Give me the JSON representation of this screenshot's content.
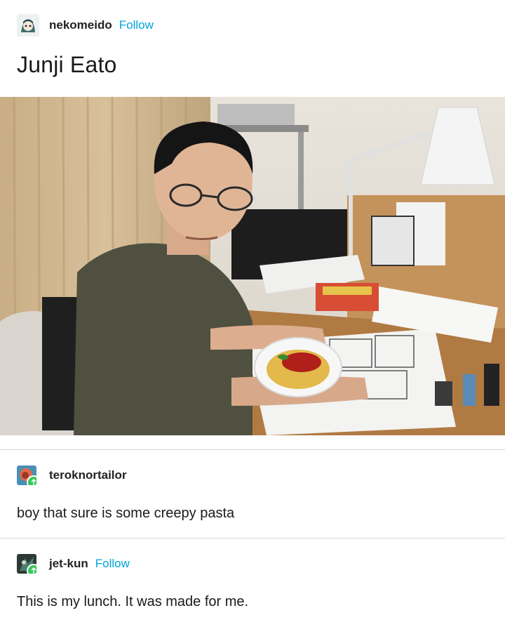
{
  "post": {
    "author": "nekomeido",
    "follow_label": "Follow",
    "title": "Junji Eato"
  },
  "reblogs": [
    {
      "author": "teroknortailor",
      "text": "boy that sure is some creepy pasta"
    },
    {
      "author": "jet-kun",
      "follow_label": "Follow",
      "text": "This is my lunch. It was made for me."
    }
  ],
  "colors": {
    "follow": "#00a5dc",
    "reblog_badge": "#34c759",
    "divider": "#d8d8d8"
  },
  "icons": [
    "avatar-nekomeido",
    "avatar-teroknortailor",
    "avatar-jet-kun",
    "reblog-icon"
  ]
}
